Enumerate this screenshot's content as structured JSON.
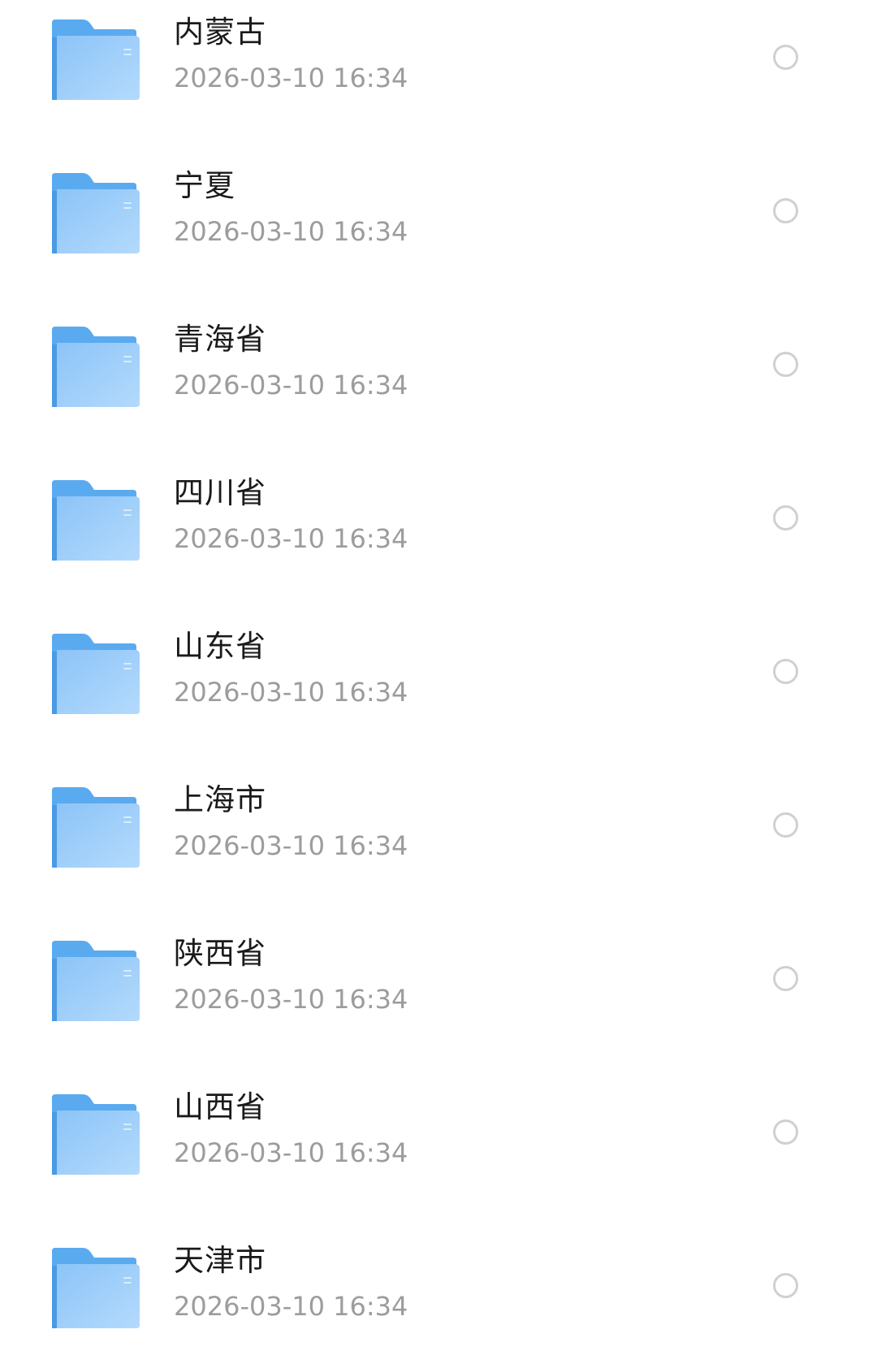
{
  "folders": [
    {
      "name": "内蒙古",
      "modified": "2026-03-10 16:34"
    },
    {
      "name": "宁夏",
      "modified": "2026-03-10 16:34"
    },
    {
      "name": "青海省",
      "modified": "2026-03-10 16:34"
    },
    {
      "name": "四川省",
      "modified": "2026-03-10 16:34"
    },
    {
      "name": "山东省",
      "modified": "2026-03-10 16:34"
    },
    {
      "name": "上海市",
      "modified": "2026-03-10 16:34"
    },
    {
      "name": "陕西省",
      "modified": "2026-03-10 16:34"
    },
    {
      "name": "山西省",
      "modified": "2026-03-10 16:34"
    },
    {
      "name": "天津市",
      "modified": "2026-03-10 16:34"
    }
  ],
  "icons": {
    "folder": "folder-icon",
    "select": "radio-circle"
  },
  "colors": {
    "folder_tab": "#5aaaf0",
    "folder_body": "#a8d2fb",
    "title_text": "#1a1a1a",
    "date_text": "#9c9c9c",
    "radio_border": "#d0d0d0"
  }
}
